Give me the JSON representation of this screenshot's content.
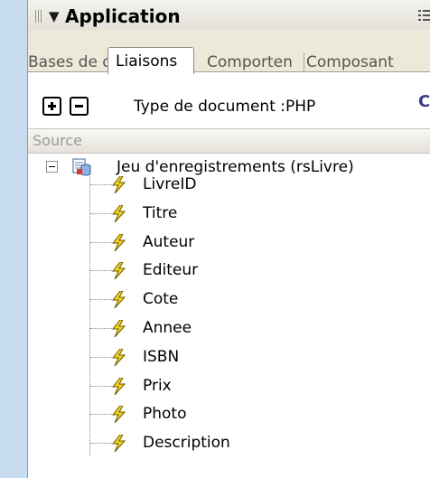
{
  "panel": {
    "title": "Application",
    "tabs": [
      {
        "label": "Bases de do",
        "active": false
      },
      {
        "label": "Liaisons",
        "active": true
      },
      {
        "label": "Comporten",
        "active": false
      },
      {
        "label": "Composant",
        "active": false
      }
    ],
    "toolbar": {
      "add_icon": "plus-box-icon",
      "remove_icon": "minus-box-icon",
      "doctype_label": "Type de document :PHP",
      "refresh_glyph": "C"
    },
    "source_header": "Source",
    "recordset": {
      "label": "Jeu d'enregistrements (rsLivre)",
      "expanded": true,
      "fields": [
        "LivreID",
        "Titre",
        "Auteur",
        "Editeur",
        "Cote",
        "Annee",
        "ISBN",
        "Prix",
        "Photo",
        "Description"
      ]
    }
  },
  "colors": {
    "background": "#c7dcef",
    "titlebar": "#e3e1d7",
    "tab_bar": "#ece9d8",
    "bolt": "#f5d21c"
  }
}
